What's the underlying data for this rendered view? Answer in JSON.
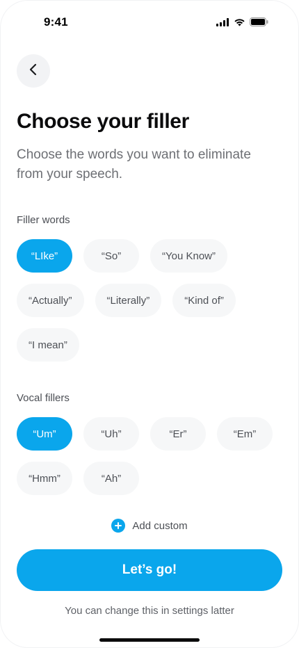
{
  "status_bar": {
    "time": "9:41",
    "icons": [
      "signal-icon",
      "wifi-icon",
      "battery-icon"
    ]
  },
  "header": {
    "back_icon": "chevron-left-icon",
    "title": "Choose your filler",
    "subtitle": "Choose the words you want to eliminate from your speech."
  },
  "filler_words": {
    "label": "Filler words",
    "chips": [
      {
        "label": "“LIke”",
        "selected": true
      },
      {
        "label": "“So”",
        "selected": false
      },
      {
        "label": "“You Know”",
        "selected": false
      },
      {
        "label": "“Actually”",
        "selected": false
      },
      {
        "label": "“Literally”",
        "selected": false
      },
      {
        "label": "“Kind of”",
        "selected": false
      },
      {
        "label": "“I mean”",
        "selected": false
      }
    ]
  },
  "vocal_fillers": {
    "label": "Vocal fillers",
    "chips": [
      {
        "label": "“Um”",
        "selected": true
      },
      {
        "label": "“Uh”",
        "selected": false
      },
      {
        "label": "“Er”",
        "selected": false
      },
      {
        "label": "“Em”",
        "selected": false
      },
      {
        "label": "“Hmm”",
        "selected": false
      },
      {
        "label": "“Ah”",
        "selected": false
      }
    ]
  },
  "add_custom": {
    "icon": "plus-circle-icon",
    "label": "Add custom"
  },
  "primary_action": {
    "label": "Let’s go!"
  },
  "footnote": "You can change this in settings latter",
  "colors": {
    "accent": "#0aa6ec",
    "chip_bg": "#f6f7f8",
    "chip_text": "#4d5056",
    "title_text": "#0b0b0c",
    "subtitle_text": "#6d6f74"
  }
}
